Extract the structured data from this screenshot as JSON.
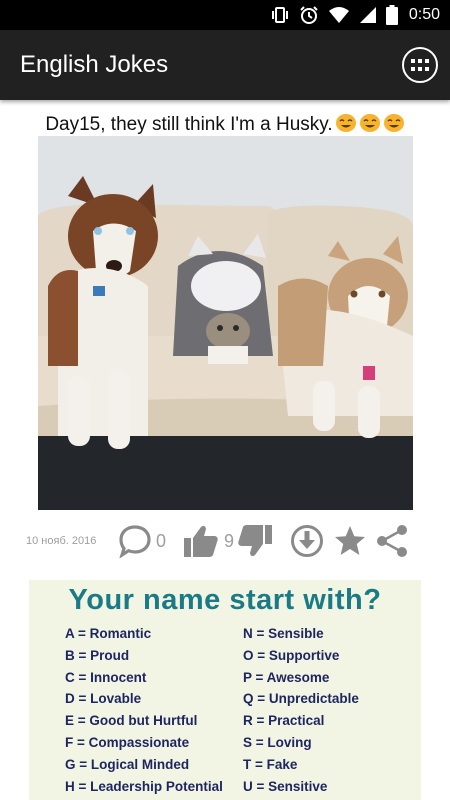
{
  "status_bar": {
    "time": "0:50",
    "icons": [
      "vibrate-icon",
      "alarm-icon",
      "wifi-icon",
      "signal-icon",
      "battery-icon"
    ]
  },
  "app_bar": {
    "title": "English Jokes",
    "menu_icon": "grid-menu-icon"
  },
  "post": {
    "title": "Day15, they still think I'm a Husky.",
    "emoji_count": 3,
    "image_desc_icon": "husky-photo"
  },
  "actions": {
    "date": "10 нояб. 2016",
    "comments": "0",
    "likes": "9",
    "icons": [
      "comment-icon",
      "thumbs-up-icon",
      "thumbs-down-icon",
      "download-icon",
      "star-icon",
      "share-icon"
    ]
  },
  "infographic": {
    "title": "Your name start with?",
    "left": [
      {
        "letter": "A",
        "meaning": "Romantic"
      },
      {
        "letter": "B",
        "meaning": "Proud"
      },
      {
        "letter": "C",
        "meaning": "Innocent"
      },
      {
        "letter": "D",
        "meaning": "Lovable"
      },
      {
        "letter": "E",
        "meaning": "Good but Hurtful"
      },
      {
        "letter": "F",
        "meaning": "Compassionate"
      },
      {
        "letter": "G",
        "meaning": "Logical Minded"
      },
      {
        "letter": "H",
        "meaning": "Leadership Potential"
      }
    ],
    "right": [
      {
        "letter": "N",
        "meaning": "Sensible"
      },
      {
        "letter": "O",
        "meaning": "Supportive"
      },
      {
        "letter": "P",
        "meaning": "Awesome"
      },
      {
        "letter": "Q",
        "meaning": "Unpredictable"
      },
      {
        "letter": "R",
        "meaning": "Practical"
      },
      {
        "letter": "S",
        "meaning": "Loving"
      },
      {
        "letter": "T",
        "meaning": "Fake"
      },
      {
        "letter": "U",
        "meaning": "Sensitive"
      }
    ]
  },
  "colors": {
    "status_bar": "#000000",
    "app_bar": "#212121",
    "icon_gray": "#8a8a8a",
    "info_title": "#1a7a86",
    "info_text": "#1d2660"
  }
}
